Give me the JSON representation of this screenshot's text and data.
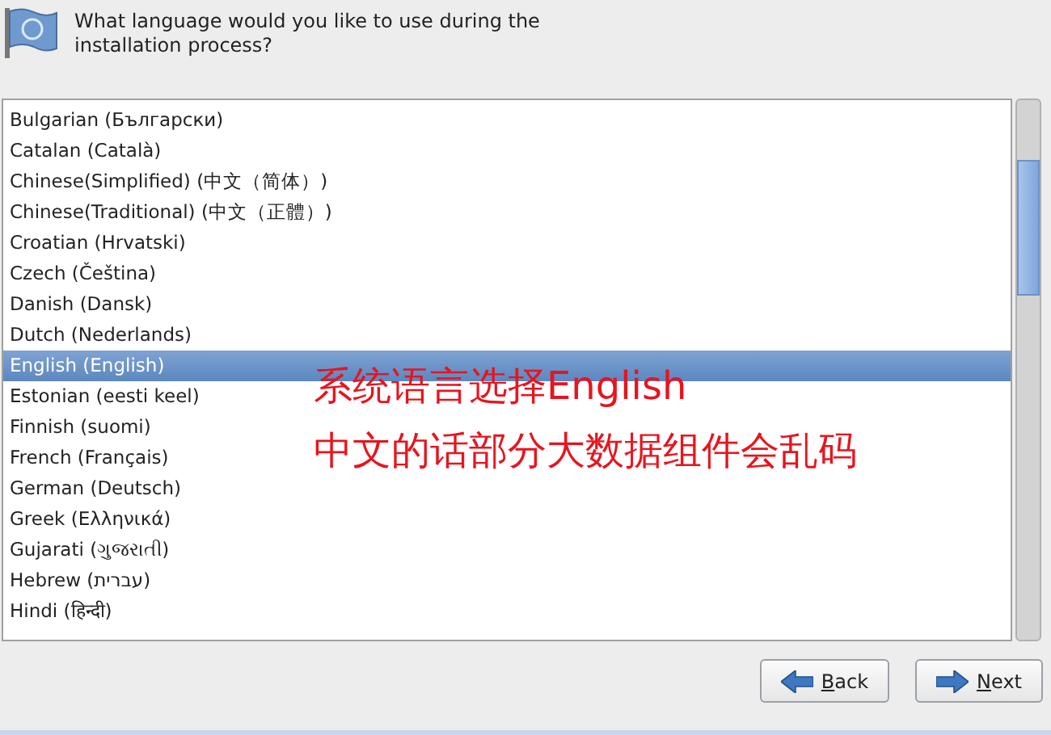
{
  "header": {
    "question": "What language would you like to use during the installation process?"
  },
  "languages": [
    {
      "label": "Bulgarian (Български)",
      "selected": false
    },
    {
      "label": "Catalan (Català)",
      "selected": false
    },
    {
      "label": "Chinese(Simplified) (中文（简体）)",
      "selected": false
    },
    {
      "label": "Chinese(Traditional) (中文（正體）)",
      "selected": false
    },
    {
      "label": "Croatian (Hrvatski)",
      "selected": false
    },
    {
      "label": "Czech (Čeština)",
      "selected": false
    },
    {
      "label": "Danish (Dansk)",
      "selected": false
    },
    {
      "label": "Dutch (Nederlands)",
      "selected": false
    },
    {
      "label": "English (English)",
      "selected": true
    },
    {
      "label": "Estonian (eesti keel)",
      "selected": false
    },
    {
      "label": "Finnish (suomi)",
      "selected": false
    },
    {
      "label": "French (Français)",
      "selected": false
    },
    {
      "label": "German (Deutsch)",
      "selected": false
    },
    {
      "label": "Greek (Ελληνικά)",
      "selected": false
    },
    {
      "label": "Gujarati (ગુજરાતી)",
      "selected": false
    },
    {
      "label": "Hebrew (עברית)",
      "selected": false
    },
    {
      "label": "Hindi (हिन्दी)",
      "selected": false
    }
  ],
  "annotation": [
    "系统语言选择English",
    "中文的话部分大数据组件会乱码"
  ],
  "buttons": [
    {
      "kind": "back",
      "label": "Back",
      "underline_first": true
    },
    {
      "kind": "next",
      "label": "Next",
      "underline_first": true
    }
  ]
}
